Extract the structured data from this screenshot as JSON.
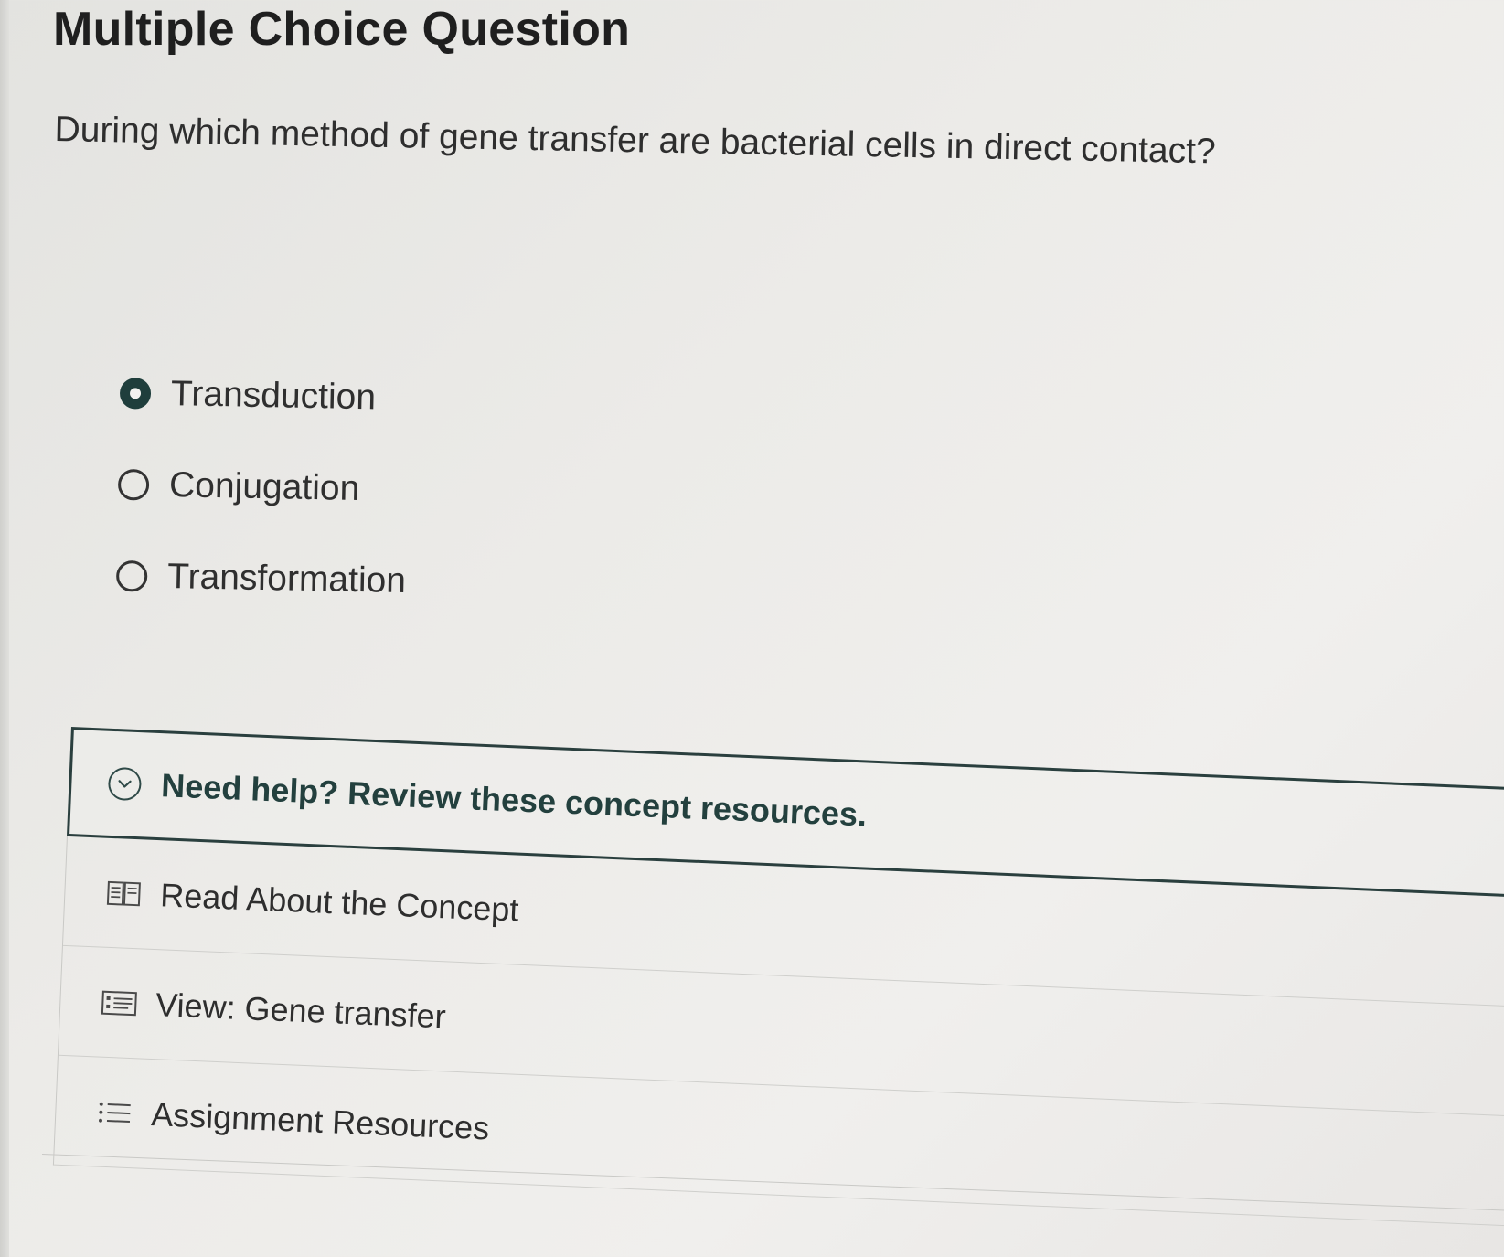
{
  "page": {
    "title": "Multiple Choice Question"
  },
  "question": {
    "text": "During which method of gene transfer are bacterial cells in direct contact?",
    "options": [
      {
        "label": "Transduction",
        "selected": true
      },
      {
        "label": "Conjugation",
        "selected": false
      },
      {
        "label": "Transformation",
        "selected": false
      }
    ]
  },
  "help": {
    "title": "Need help? Review these concept resources.",
    "icon": "chevron-down-circle-icon",
    "resources": [
      {
        "label": "Read About the Concept",
        "icon": "book-icon"
      },
      {
        "label": "View: Gene transfer",
        "icon": "video-icon"
      },
      {
        "label": "Assignment Resources",
        "icon": "list-icon"
      }
    ]
  },
  "colors": {
    "accent": "#1f3e3c",
    "text": "#2e2e2e",
    "background": "#ecebe8"
  }
}
